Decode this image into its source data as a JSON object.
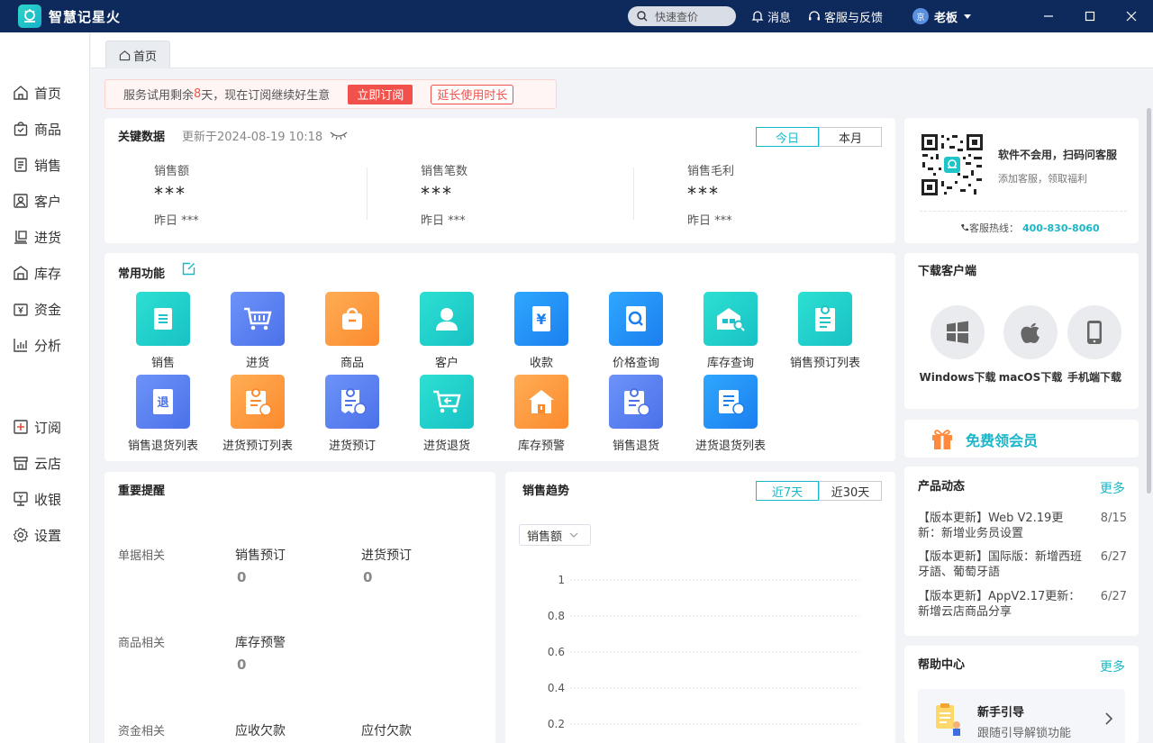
{
  "app": {
    "title": "智慧记星火",
    "search_placeholder": "快速查价",
    "messages": "消息",
    "support": "客服与反馈",
    "user": "老板",
    "avatar_text": "京"
  },
  "sidebar": {
    "items": [
      "首页",
      "商品",
      "销售",
      "客户",
      "进货",
      "库存",
      "资金",
      "分析"
    ],
    "bottom_items": [
      "订阅",
      "云店",
      "收银",
      "设置"
    ]
  },
  "tabs": [
    "首页"
  ],
  "trial": {
    "prefix": "服务试用剩余",
    "days": "8",
    "suffix": "天，现在订阅继续好生意",
    "subscribe": "立即订阅",
    "extend": "延长使用时长"
  },
  "key_data": {
    "title": "关键数据",
    "updated": "更新于2024-08-19 10:18",
    "periods": [
      "今日",
      "本月"
    ],
    "active_period": "今日",
    "metrics": [
      {
        "label": "销售额",
        "value": "***",
        "yesterday": "昨日 ***"
      },
      {
        "label": "销售笔数",
        "value": "***",
        "yesterday": "昨日 ***"
      },
      {
        "label": "销售毛利",
        "value": "***",
        "yesterday": "昨日 ***"
      }
    ]
  },
  "functions": {
    "title": "常用功能",
    "items": [
      "销售",
      "进货",
      "商品",
      "客户",
      "收款",
      "价格查询",
      "库存查询",
      "销售预订列表",
      "销售退货列表",
      "进货预订列表",
      "进货预订",
      "进货退货",
      "库存预警",
      "销售退货",
      "进货退货列表"
    ],
    "icon_glyphs": {
      "refund": "退",
      "yuan": "¥"
    }
  },
  "reminders": {
    "title": "重要提醒",
    "groups": [
      {
        "label": "单据相关",
        "items": [
          {
            "name": "销售预订",
            "value": "0"
          },
          {
            "name": "进货预订",
            "value": "0"
          }
        ]
      },
      {
        "label": "商品相关",
        "items": [
          {
            "name": "库存预警",
            "value": "0"
          }
        ]
      },
      {
        "label": "资金相关",
        "items": [
          {
            "name": "应收欠款",
            "value": ""
          },
          {
            "name": "应付欠款",
            "value": ""
          }
        ]
      }
    ]
  },
  "sales_trend": {
    "title": "销售趋势",
    "periods": [
      "近7天",
      "近30天"
    ],
    "active_period": "近7天",
    "metric_select": "销售额"
  },
  "chart_data": {
    "type": "line",
    "title": "",
    "y_ticks": [
      "1",
      "0.8",
      "0.6",
      "0.4",
      "0.2"
    ],
    "ylim": [
      0,
      1
    ],
    "series": [],
    "grid": true
  },
  "service": {
    "title": "软件不会用，扫码问客服",
    "subtitle": "添加客服，领取福利",
    "hotline_label": "客服热线：",
    "hotline": "400-830-8060"
  },
  "download": {
    "title": "下载客户端",
    "items": [
      "Windows下载",
      "macOS下载",
      "手机端下载"
    ]
  },
  "vip": {
    "label": "免费领会员"
  },
  "news": {
    "title": "产品动态",
    "more": "更多",
    "items": [
      {
        "text": "【版本更新】Web V2.19更新：新增业务员设置",
        "date": "8/15"
      },
      {
        "text": "【版本更新】国际版：新增西班牙語、葡萄牙語",
        "date": "6/27"
      },
      {
        "text": "【版本更新】AppV2.17更新：新增云店商品分享",
        "date": "6/27"
      }
    ]
  },
  "help": {
    "title": "帮助中心",
    "more": "更多",
    "guide_title": "新手引导",
    "guide_sub": "跟随引导解锁功能"
  },
  "colors": {
    "titlebar": "#0e2a5c",
    "accent": "#1bb7c8",
    "danger": "#f2514b"
  }
}
